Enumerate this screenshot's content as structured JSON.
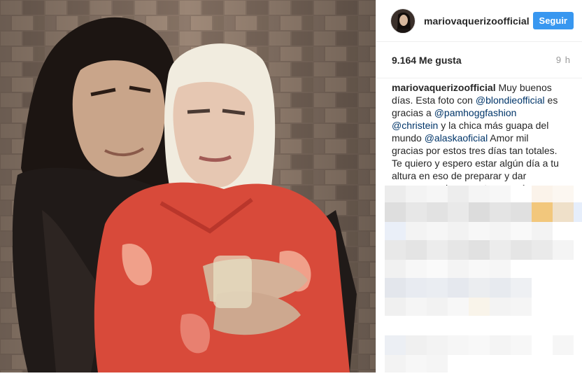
{
  "post": {
    "username": "mariovaquerizoofficial",
    "follow_label": "Seguir",
    "likes": "9.164 Me gusta",
    "time_ago": "9 h"
  },
  "caption": {
    "user": "mariovaquerizoofficial",
    "t1": " Muy buenos días. Esta foto con ",
    "m1": "@blondieofficial",
    "t2": " es gracias a ",
    "m2": "@pamhoggfashion",
    "t3": " ",
    "m3": "@christein",
    "t4": " y la chica más guapa del mundo ",
    "m4": "@alaskaoficial",
    "t5": " Amor mil gracias por estos tres días tan totales. Te quiero y espero estar algún día a tu altura en eso de preparar y dar sorpresas. ahora me toca a mí"
  },
  "icons": {
    "photo": "post-photo",
    "avatar": "avatar-image",
    "comments": "blurred-comments"
  },
  "colors": {
    "follow": "#3897f0",
    "mention": "#003569",
    "text": "#262626",
    "muted": "#999999"
  }
}
